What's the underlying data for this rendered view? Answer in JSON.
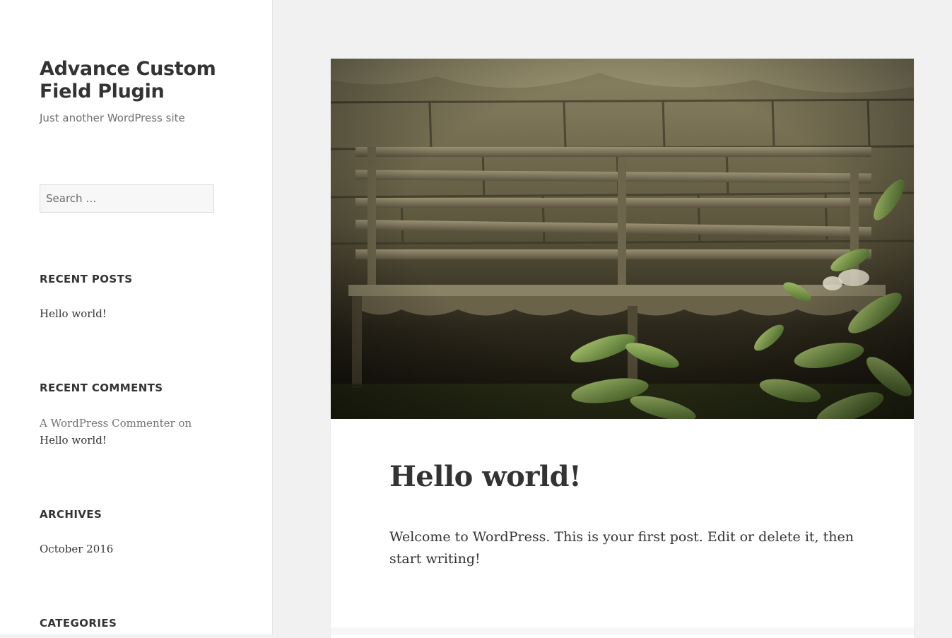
{
  "site": {
    "title": "Advance Custom Field Plugin",
    "description": "Just another WordPress site"
  },
  "search": {
    "placeholder": "Search …"
  },
  "widgets": {
    "recent_posts": {
      "title": "Recent Posts",
      "items": [
        "Hello world!"
      ]
    },
    "recent_comments": {
      "title": "Recent Comments",
      "author": "A WordPress Commenter",
      "connector": "on",
      "post": "Hello world!"
    },
    "archives": {
      "title": "Archives",
      "items": [
        "October 2016"
      ]
    },
    "categories": {
      "title": "Categories"
    }
  },
  "post": {
    "title": "Hello world!",
    "content": "Welcome to WordPress. This is your first post. Edit or delete it, then start writing!",
    "featured_image": "wooden-bench-against-stone-wall-with-plants"
  },
  "colors": {
    "sidebar_bg": "#ffffff",
    "page_bg": "#f1f1f1",
    "text": "#333333",
    "muted": "#707070"
  }
}
